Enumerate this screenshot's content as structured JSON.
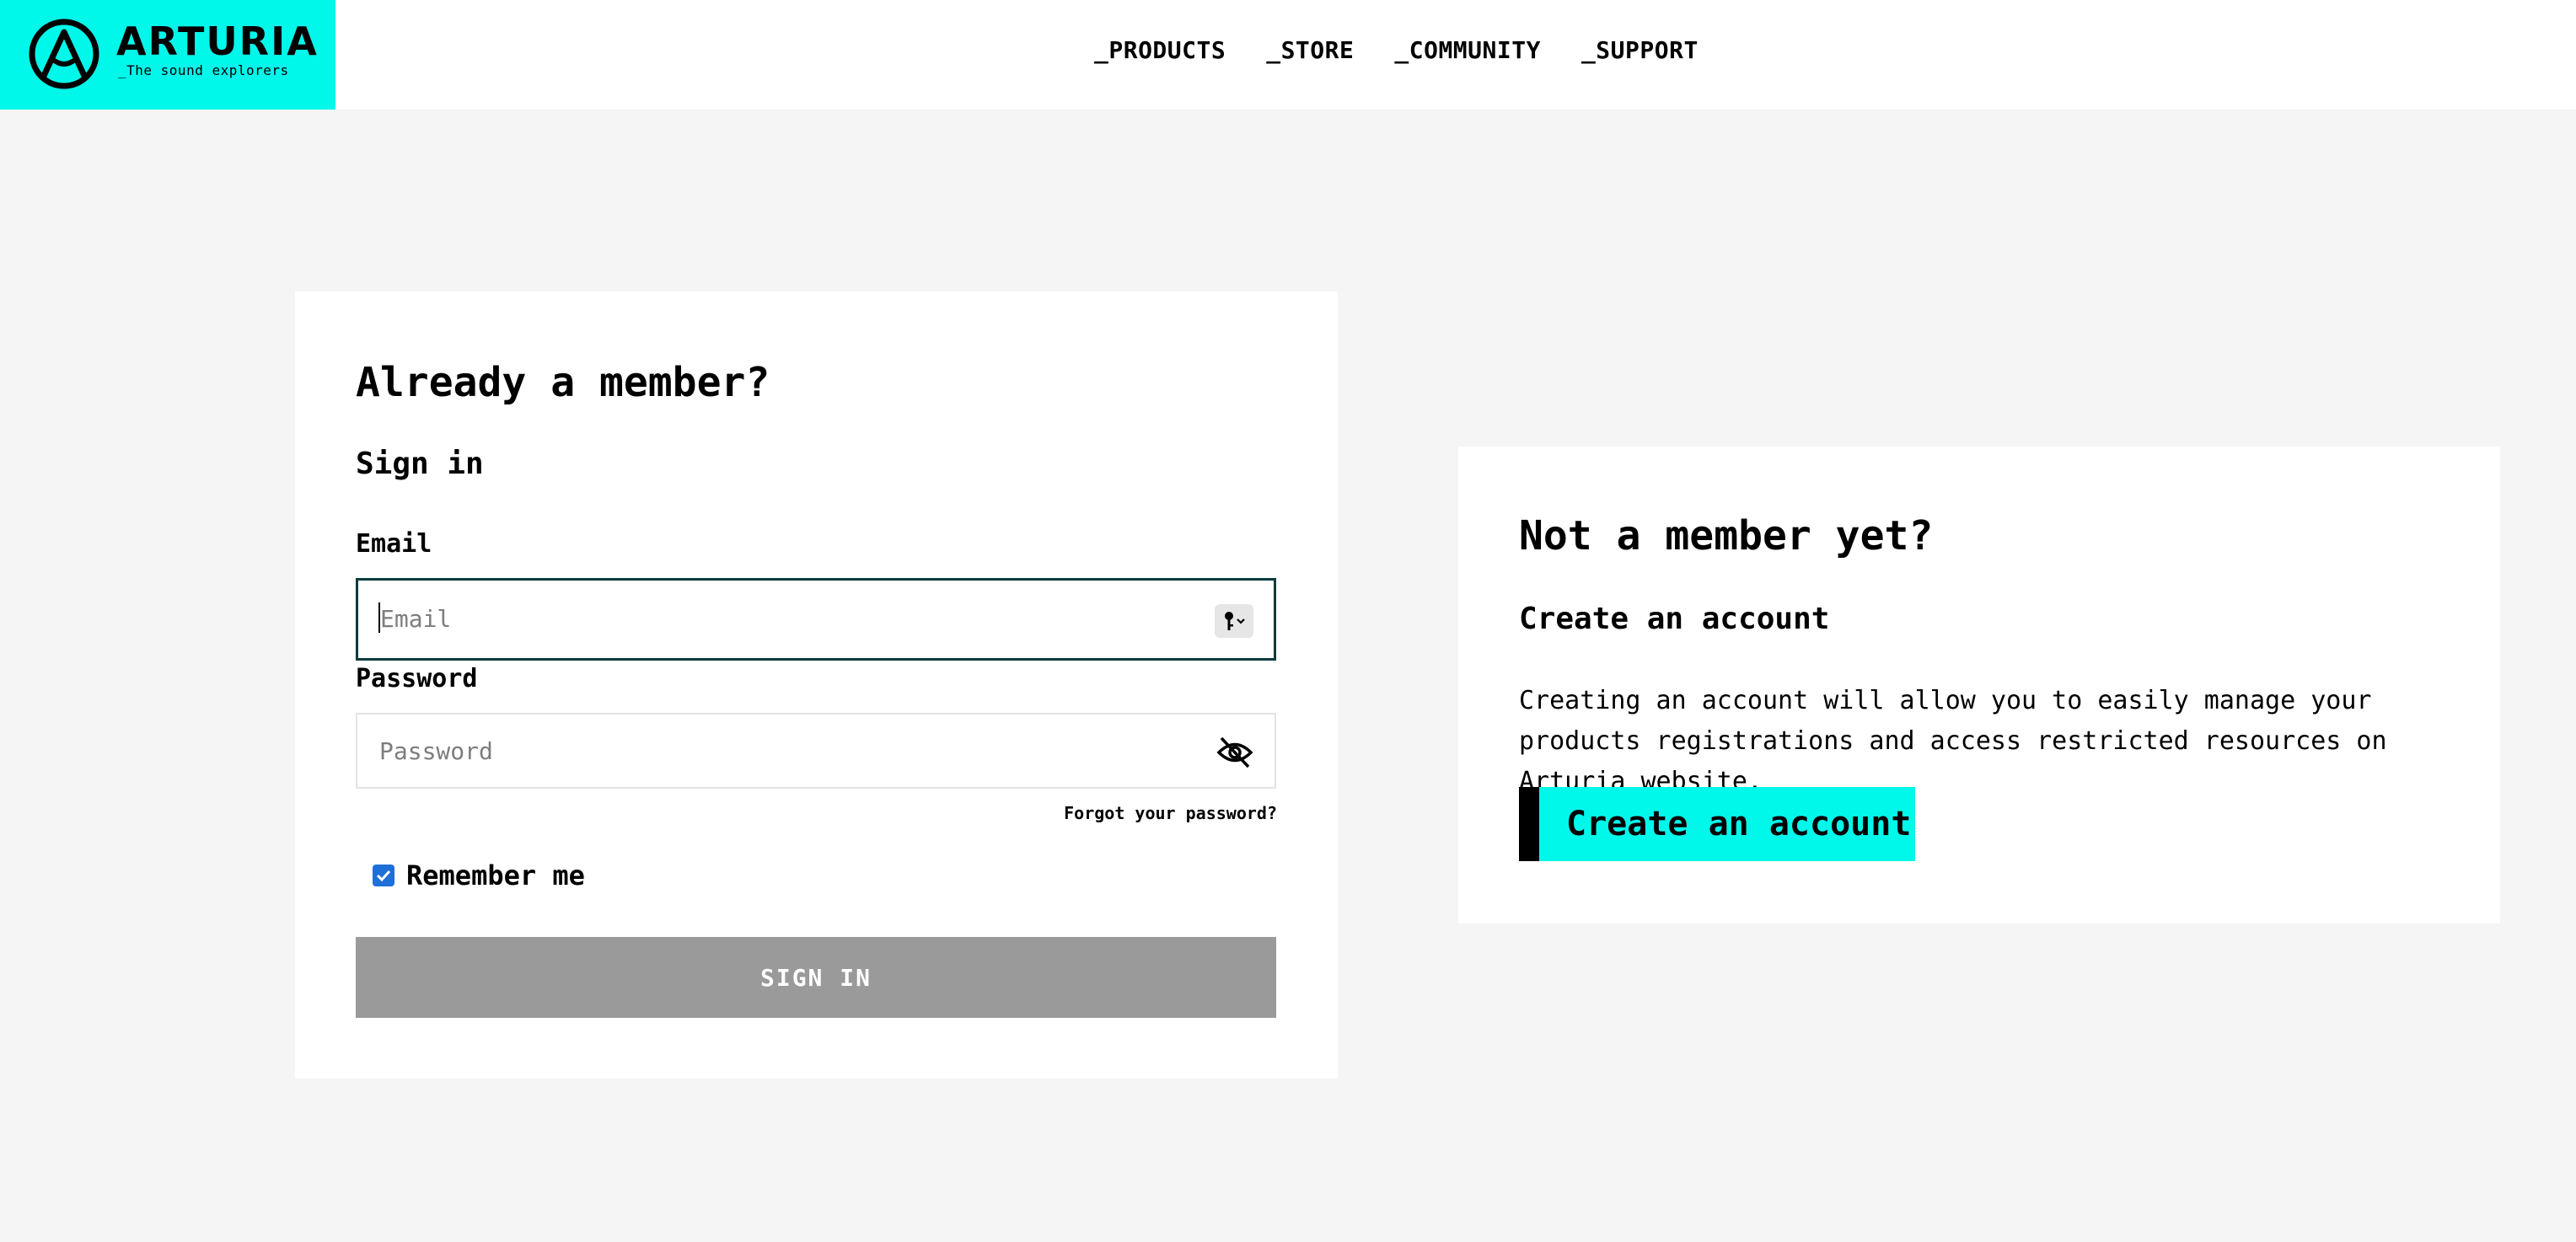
{
  "brand": {
    "name": "ARTURIA",
    "tagline": "_The sound explorers",
    "accent": "#00f8ea"
  },
  "nav": {
    "items": [
      "_PRODUCTS",
      "_STORE",
      "_COMMUNITY",
      "_SUPPORT"
    ]
  },
  "signin": {
    "title": "Already a member?",
    "subtitle": "Sign in",
    "email_label": "Email",
    "email_placeholder": "Email",
    "password_label": "Password",
    "password_placeholder": "Password",
    "forgot_link": "Forgot your password?",
    "remember_label": "Remember me",
    "remember_checked": true,
    "button_label": "SIGN IN"
  },
  "register": {
    "title": "Not a member yet?",
    "subtitle": "Create an account",
    "description": "Creating an account will allow you to easily manage your products registrations and access restricted resources on Arturia website.",
    "button_label": "Create an account"
  },
  "icons": {
    "logo": "arturia-logo-icon",
    "password_manager": "key-icon",
    "toggle_visibility": "eye-off-icon"
  }
}
